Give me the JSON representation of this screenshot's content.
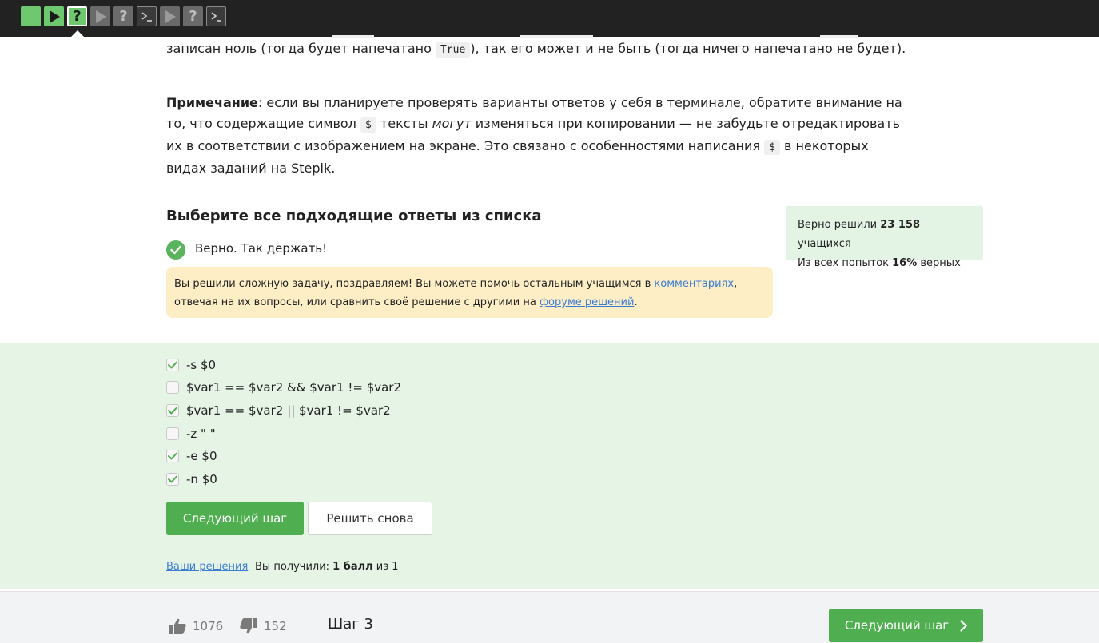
{
  "steps": [
    {
      "type": "text",
      "state": "passed"
    },
    {
      "type": "video",
      "state": "passed"
    },
    {
      "type": "quiz",
      "state": "current"
    },
    {
      "type": "video",
      "state": "pending"
    },
    {
      "type": "quiz",
      "state": "pending"
    },
    {
      "type": "code",
      "state": "pending"
    },
    {
      "type": "video",
      "state": "pending"
    },
    {
      "type": "quiz",
      "state": "pending"
    },
    {
      "type": "code",
      "state": "pending"
    }
  ],
  "lesson": {
    "p1_before": "записан ноль (тогда будет напечатано ",
    "p1_code": "True",
    "p1_after": "), так его может и не быть (тогда ничего напечатано не будет).",
    "p2_bold": "Примечание",
    "p2_a": ": если вы планируете проверять варианты ответов у себя в терминале, обратите внимание на то, что содержащие символ ",
    "p2_code1": "$",
    "p2_b": " тексты ",
    "p2_em": "могут",
    "p2_c": " изменяться при копировании — не забудьте отредактировать их в соответствии с изображением на экране. Это связано с особенностями написания ",
    "p2_code2": "$",
    "p2_d": " в некоторых видах заданий на Stepik."
  },
  "quiz": {
    "title": "Выберите все подходящие ответы из списка",
    "correct_message": "Верно. Так держать!",
    "notice_a": "Вы решили сложную задачу, поздравляем! Вы можете помочь остальным учащимся в ",
    "notice_link1": "комментариях",
    "notice_b": ", отвечая на их вопросы, или сравнить своё решение с другими на ",
    "notice_link2": "форуме решений",
    "notice_c": ".",
    "options": [
      {
        "label": "-s $0",
        "checked": true
      },
      {
        "label": "$var1 == $var2 && $var1 != $var2",
        "checked": false
      },
      {
        "label": "$var1 == $var2 || $var1 != $var2",
        "checked": true
      },
      {
        "label": "-z \" \"",
        "checked": false
      },
      {
        "label": "-e $0",
        "checked": true
      },
      {
        "label": "-n $0",
        "checked": true
      }
    ],
    "next_button": "Следующий шаг",
    "retry_button": "Решить снова",
    "your_solutions": "Ваши решения",
    "score_prefix": "Вы получили: ",
    "score_bold": "1 балл",
    "score_suffix": " из 1"
  },
  "stats": {
    "solved_prefix": "Верно решили ",
    "solved_count": "23 158",
    "solved_suffix": " учащихся",
    "attempts_prefix": "Из всех попыток ",
    "attempts_percent": "16%",
    "attempts_suffix": " верных"
  },
  "footer": {
    "likes": "1076",
    "dislikes": "152",
    "step_label": "Шаг 3",
    "next_button": "Следующий шаг"
  },
  "colors": {
    "accent_green": "#4fae4f",
    "success_bg": "#e6f4e6",
    "notice_bg": "#fdeec5",
    "link": "#3a7bd5",
    "topbar": "#222222"
  }
}
